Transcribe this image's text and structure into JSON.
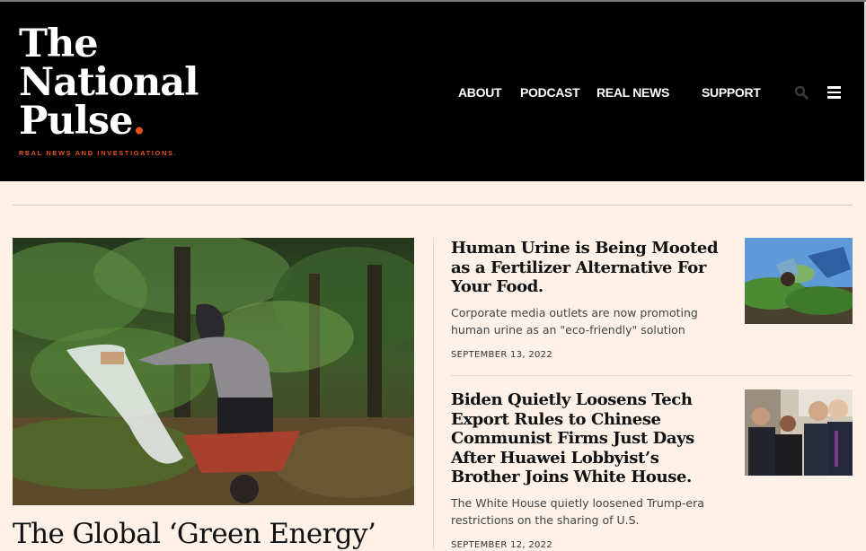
{
  "site": {
    "logo_line1": "The",
    "logo_line2": "National",
    "logo_line3": "Pulse",
    "logo_dot": ".",
    "tagline": "REAL NEWS AND INVESTIGATIONS",
    "tagline_dot": "."
  },
  "nav": {
    "items": [
      "ABOUT",
      "PODCAST",
      "REAL NEWS",
      "SUPPORT"
    ],
    "icons": [
      "search-icon",
      "menu-icon"
    ]
  },
  "feature": {
    "title": "The Global ‘Green Energy’"
  },
  "stories": [
    {
      "title": "Human Urine is Being Mooted as a Fertilizer Alternative For Your Food.",
      "dek": "Corporate media outlets are now promoting human urine as an \"eco-friendly\" solution",
      "date": "SEPTEMBER 13, 2022"
    },
    {
      "title": "Biden Quietly Loosens Tech Export Rules to Chinese Communist Firms Just Days After Huawei Lobbyist’s Brother Joins White House.",
      "dek": "The White House quietly loosened Trump-era restrictions on the sharing of U.S.",
      "date": "SEPTEMBER 12, 2022"
    }
  ],
  "colors": {
    "background": "#fdf1e8",
    "header": "#000000",
    "accent": "#e5501b"
  }
}
